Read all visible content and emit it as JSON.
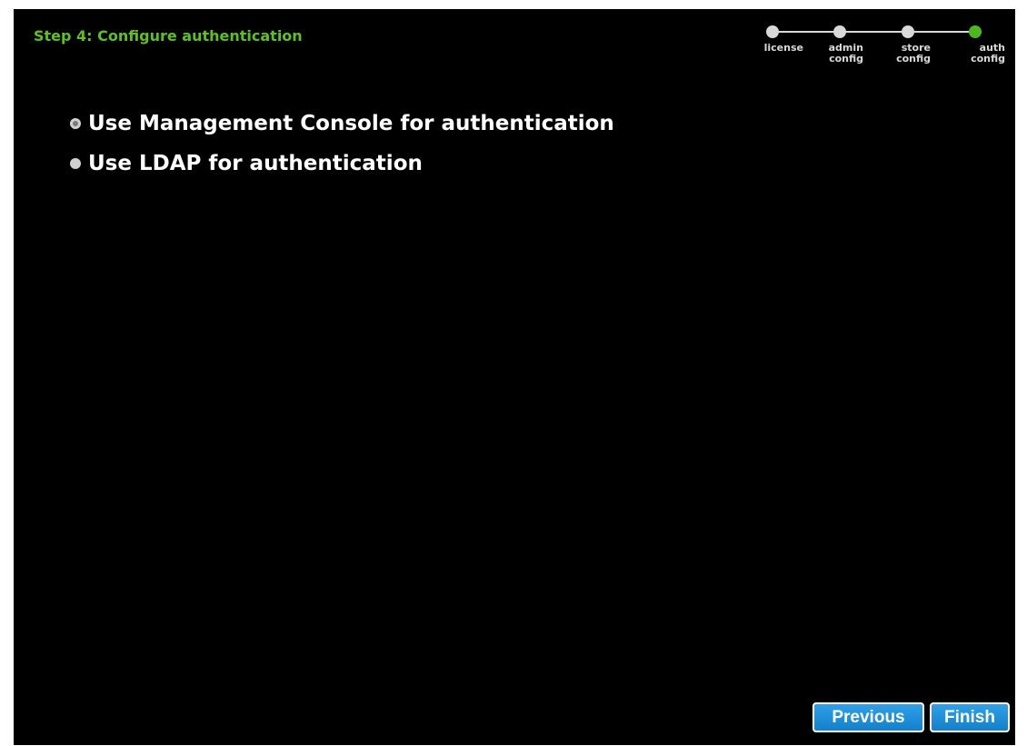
{
  "header": {
    "step_title": "Step 4: Configure authentication"
  },
  "progress": {
    "steps": [
      {
        "label": "license",
        "current": false
      },
      {
        "label": "admin\nconfig",
        "current": false
      },
      {
        "label": "store\nconfig",
        "current": false
      },
      {
        "label": "auth\nconfig",
        "current": true
      }
    ],
    "colors": {
      "inactive": "#d9d9d9",
      "current": "#4db71d"
    }
  },
  "auth_options": [
    {
      "label": "Use Management Console for authentication",
      "selected": true
    },
    {
      "label": "Use LDAP for authentication",
      "selected": false
    }
  ],
  "footer": {
    "previous_label": "Previous",
    "finish_label": "Finish"
  },
  "colors": {
    "background": "#000000",
    "title": "#5fc21c",
    "button": "#1a8ad8"
  }
}
